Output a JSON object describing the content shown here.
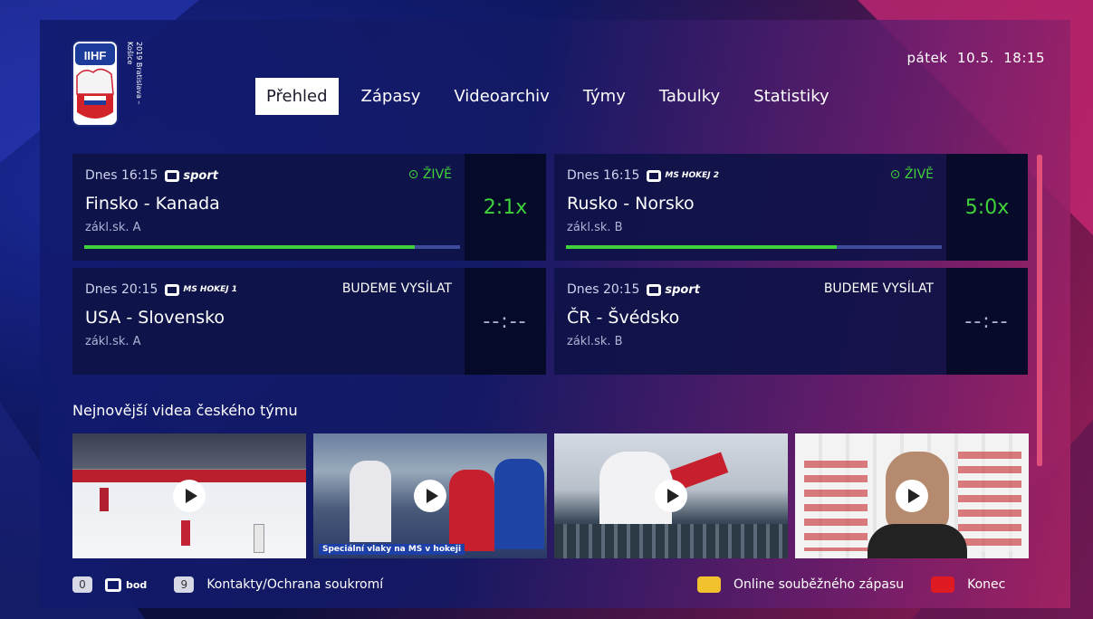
{
  "header": {
    "logo_text": "IIHF",
    "logo_side_lines": [
      "2019",
      "Bratislava – Košice"
    ],
    "tabs": [
      "Přehled",
      "Zápasy",
      "Videoarchiv",
      "Týmy",
      "Tabulky",
      "Statistiky"
    ],
    "active_tab": "Přehled",
    "day": "pátek",
    "date": "10.5.",
    "time": "18:15"
  },
  "matches": [
    {
      "time": "Dnes 16:15",
      "channel": "sport",
      "status": "ŽIVĚ",
      "teams": "Finsko - Kanada",
      "group": "zákl.sk. A",
      "score": "2:1x",
      "progress": 0.88
    },
    {
      "time": "Dnes 16:15",
      "channel": "MS HOKEJ 2",
      "status": "ŽIVĚ",
      "teams": "Rusko - Norsko",
      "group": "zákl.sk. B",
      "score": "5:0x",
      "progress": 0.72
    },
    {
      "time": "Dnes 20:15",
      "channel": "MS HOKEJ 1",
      "status": "BUDEME VYSÍLAT",
      "teams": "USA - Slovensko",
      "group": "zákl.sk. A",
      "score": "--:--"
    },
    {
      "time": "Dnes 20:15",
      "channel": "sport",
      "status": "BUDEME VYSÍLAT",
      "teams": "ČR - Švédsko",
      "group": "zákl.sk. B",
      "score": "--:--"
    }
  ],
  "videos": {
    "title": "Nejnovější videa českého týmu",
    "items": [
      {
        "caption": ""
      },
      {
        "caption": "Speciální vlaky na MS v hokeji"
      },
      {
        "caption": ""
      },
      {
        "caption": ""
      }
    ]
  },
  "footer": {
    "key_0": "0",
    "bod_label": "bod",
    "key_9": "9",
    "contacts": "Kontakty/Ochrana soukromí",
    "yellow_label": "Online souběžného zápasu",
    "red_label": "Konec",
    "yellow_color": "#f2c12e",
    "red_color": "#e01a22"
  },
  "colors": {
    "live": "#3fd23a",
    "accent": "#e0507a"
  }
}
